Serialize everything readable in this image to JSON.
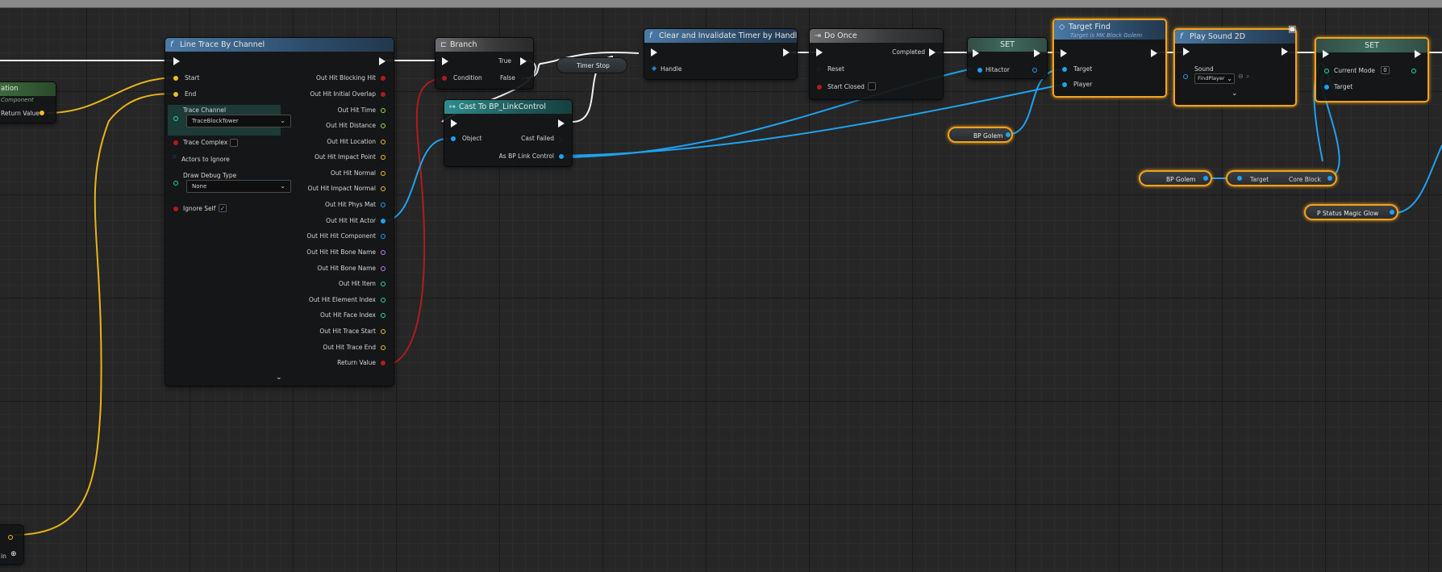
{
  "nodes": {
    "partial_left": {
      "title": "ation",
      "subtitle": "Component",
      "return_label": "Return Value"
    },
    "partial_bottom": {
      "label": "in"
    },
    "line_trace": {
      "title": "Line Trace By Channel",
      "inputs": {
        "start": "Start",
        "end": "End",
        "trace_channel": "Trace Channel",
        "trace_channel_value": "TraceBlockTower",
        "trace_complex": "Trace Complex",
        "actors_to_ignore": "Actors to Ignore",
        "draw_debug_type": "Draw Debug Type",
        "draw_debug_value": "None",
        "ignore_self": "Ignore Self"
      },
      "outputs": [
        "Out Hit Blocking Hit",
        "Out Hit Initial Overlap",
        "Out Hit Time",
        "Out Hit Distance",
        "Out Hit Location",
        "Out Hit Impact Point",
        "Out Hit Normal",
        "Out Hit Impact Normal",
        "Out Hit Phys Mat",
        "Out Hit Hit Actor",
        "Out Hit Hit Component",
        "Out Hit Hit Bone Name",
        "Out Hit Bone Name",
        "Out Hit Item",
        "Out Hit Element Index",
        "Out Hit Face Index",
        "Out Hit Trace Start",
        "Out Hit Trace End",
        "Return Value"
      ]
    },
    "branch": {
      "title": "Branch",
      "condition": "Condition",
      "true_label": "True",
      "false_label": "False"
    },
    "timer_stop": {
      "label": "Timer Stop"
    },
    "cast": {
      "title": "Cast To BP_LinkControl",
      "object": "Object",
      "cast_failed": "Cast Failed",
      "as_output": "As BP Link Control"
    },
    "clear_timer": {
      "title": "Clear and Invalidate Timer by Handle",
      "handle": "Handle"
    },
    "do_once": {
      "title": "Do Once",
      "completed": "Completed",
      "reset": "Reset",
      "start_closed": "Start Closed"
    },
    "set1": {
      "title": "SET",
      "hitactor": "Hitactor"
    },
    "bp_golem1": {
      "label": "BP Golem"
    },
    "target_find": {
      "title": "Target Find",
      "subtitle": "Target is MK Block Golem",
      "target": "Target",
      "player": "Player"
    },
    "play_sound": {
      "title": "Play Sound 2D",
      "sound": "Sound",
      "sound_value": "FindPlayer"
    },
    "set2": {
      "title": "SET",
      "current_mode": "Current Mode",
      "current_mode_value": "0",
      "target": "Target"
    },
    "bp_golem2": {
      "label": "BP Golem"
    },
    "core_block": {
      "target": "Target",
      "output": "Core Block"
    },
    "status_glow": {
      "label": "P Status Magic Glow"
    }
  },
  "colors": {
    "exec": "#f2f2f2",
    "object": "#1fa2f0",
    "bool": "#b01c1c",
    "float": "#9fdc3f",
    "vector": "#f0c020",
    "name": "#c07ef0",
    "int": "#1ee0a0",
    "struct": "#2a7fd8",
    "selection": "#f2a21d"
  }
}
